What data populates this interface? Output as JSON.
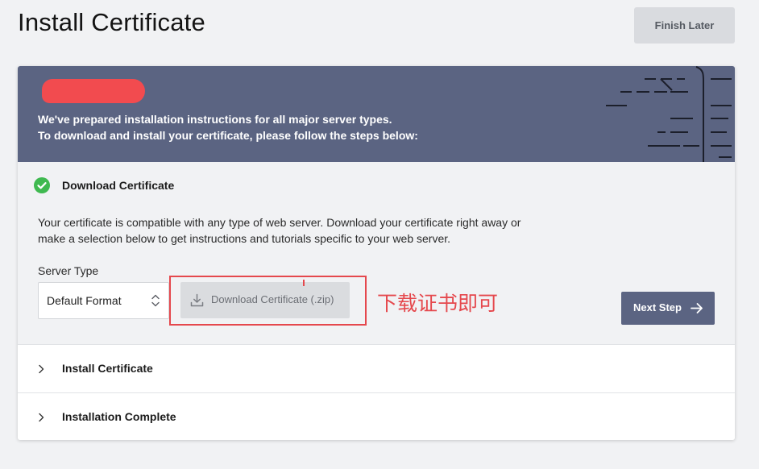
{
  "header": {
    "title": "Install Certificate",
    "finish_later_label": "Finish Later"
  },
  "banner": {
    "line1": "We've prepared installation instructions for all major server types.",
    "line2": "To download and install your certificate, please follow the steps below:"
  },
  "steps": [
    {
      "title": "Download Certificate",
      "status": "complete",
      "description": "Your certificate is compatible with any type of web server. Download your certificate right away or make a selection below to get instructions and tutorials specific to your web server.",
      "server_type_label": "Server Type",
      "server_type_value": "Default Format",
      "download_label": "Download Certificate (.zip)",
      "next_label": "Next Step"
    },
    {
      "title": "Install Certificate",
      "status": "collapsed"
    },
    {
      "title": "Installation Complete",
      "status": "collapsed"
    }
  ],
  "annotation": {
    "text": "下载证书即可"
  },
  "colors": {
    "banner": "#5b6482",
    "accent_button": "#5b6482",
    "check": "#3fb950",
    "annotation": "#e5484d"
  }
}
